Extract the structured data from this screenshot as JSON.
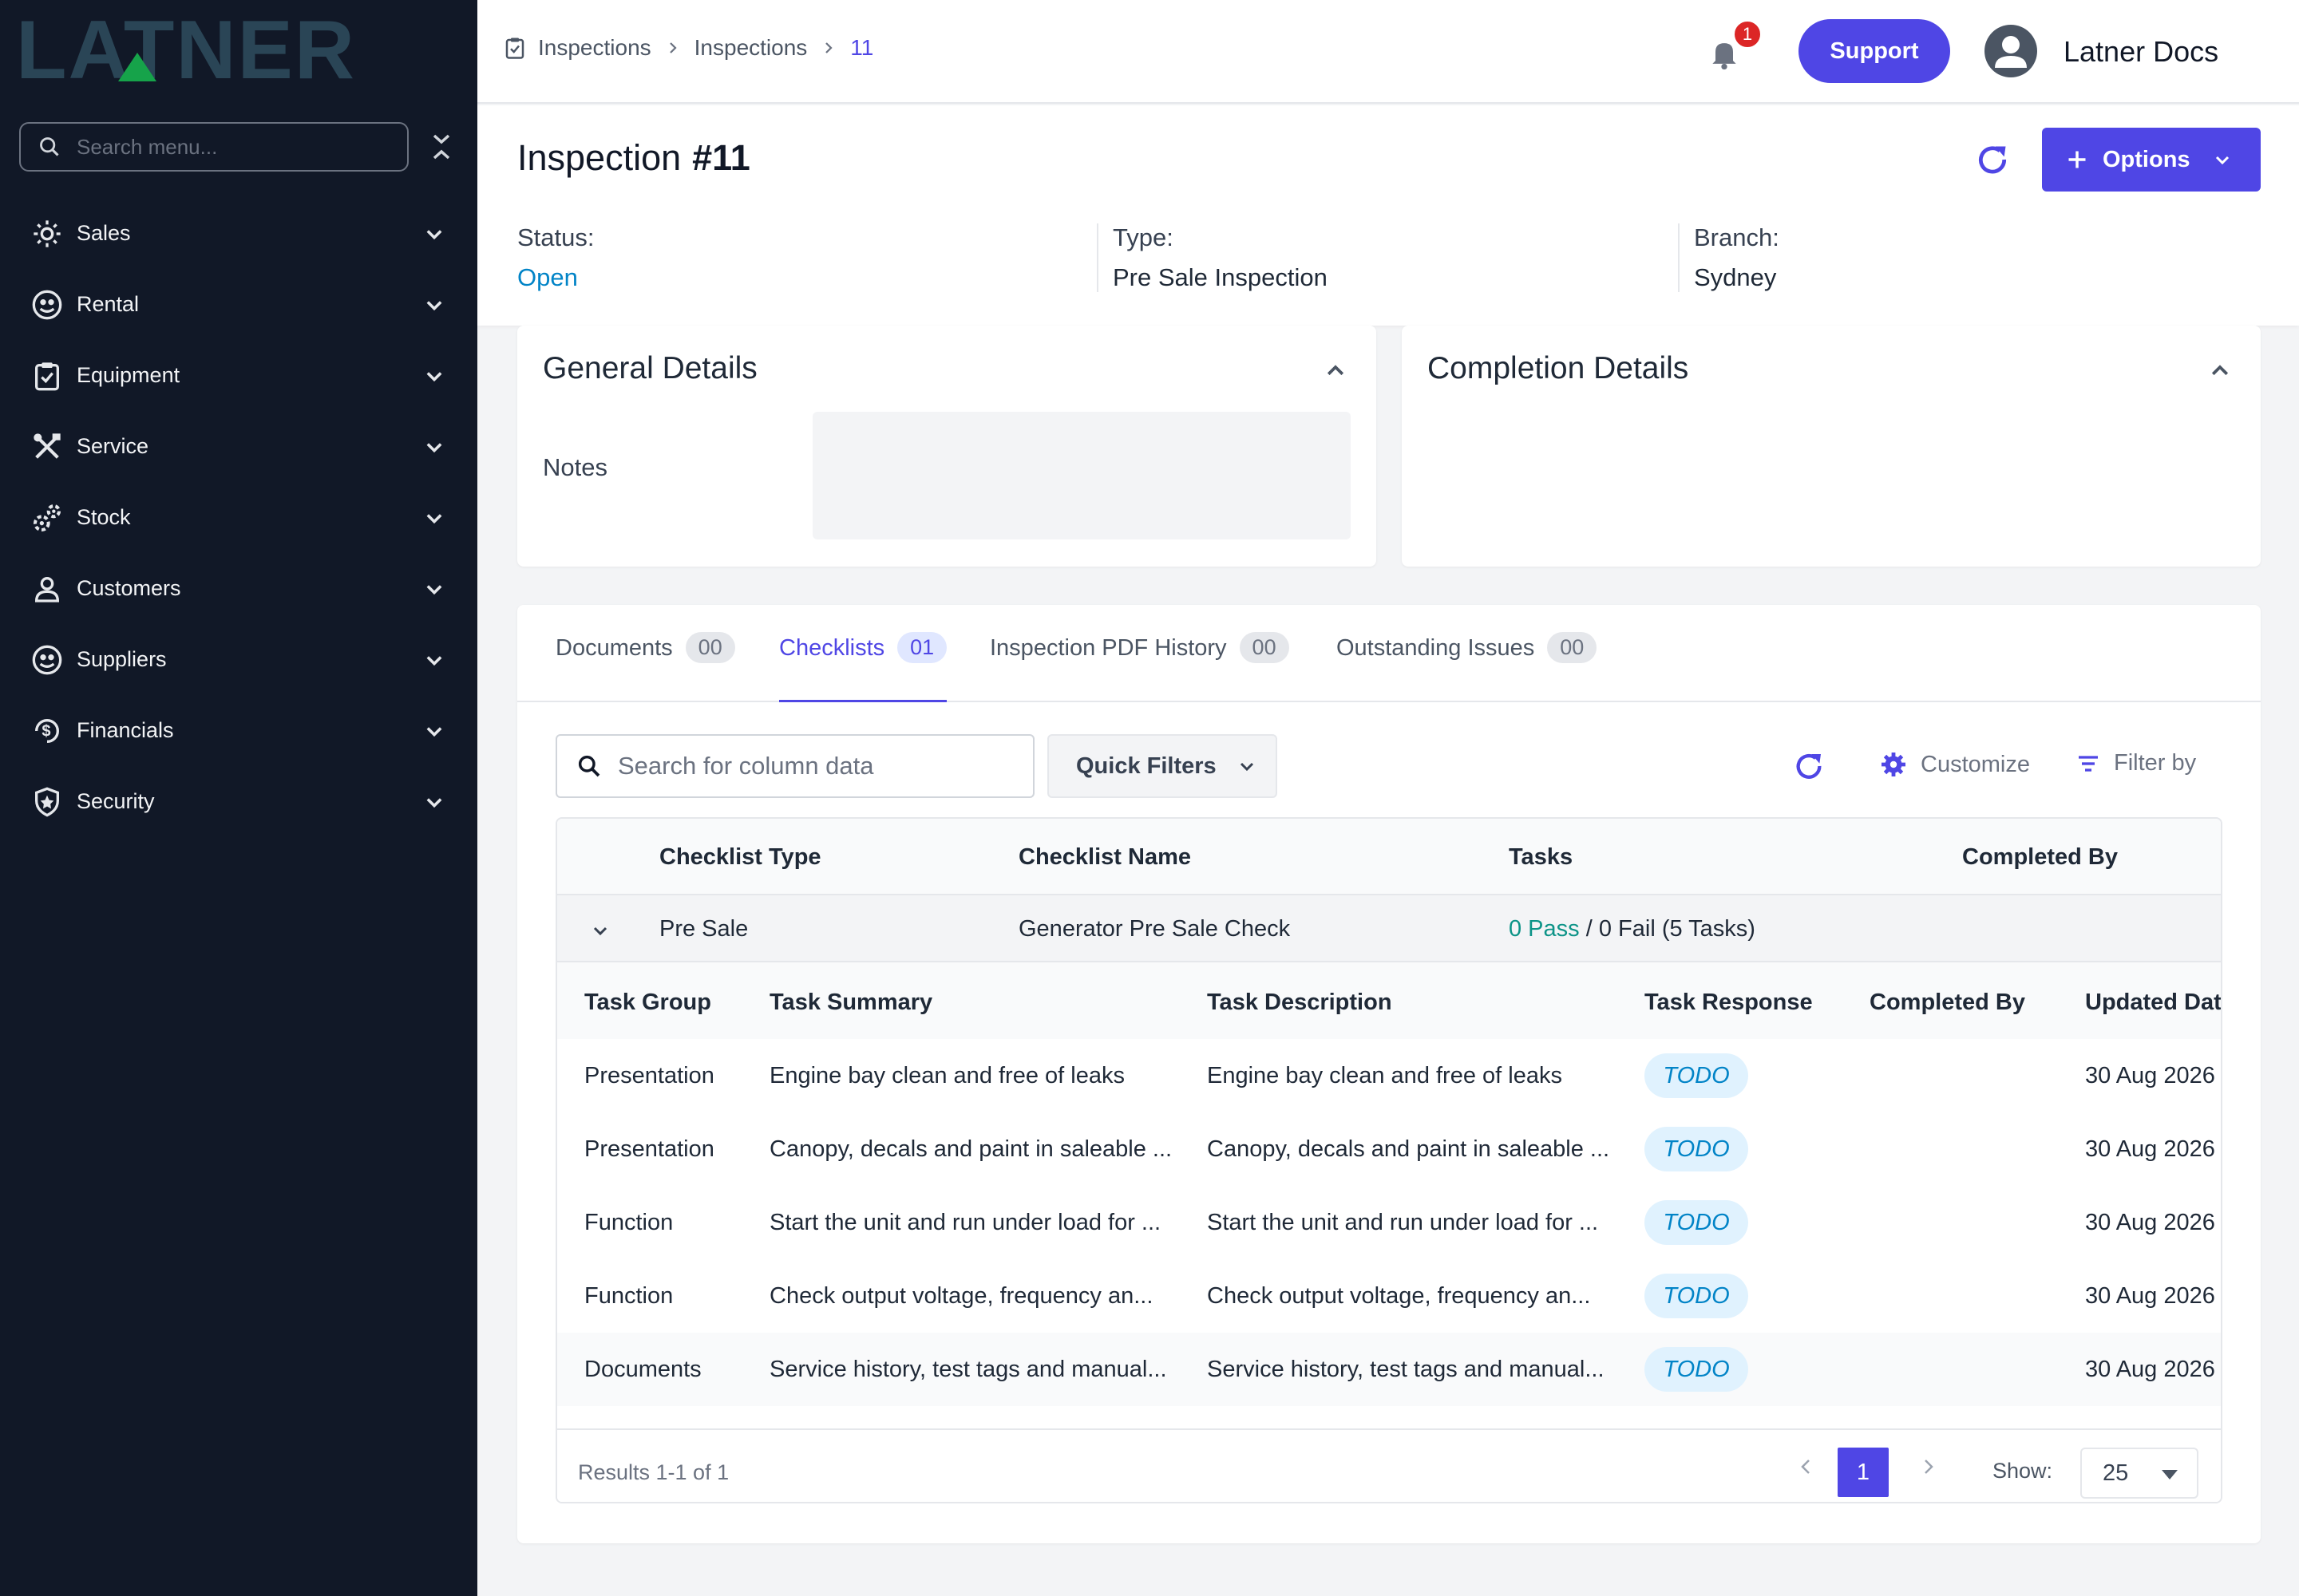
{
  "sidebar": {
    "brand": "LATNER",
    "search_placeholder": "Search menu...",
    "items": [
      {
        "label": "Sales",
        "icon": "sales-icon"
      },
      {
        "label": "Rental",
        "icon": "rental-icon"
      },
      {
        "label": "Equipment",
        "icon": "clipboard-icon"
      },
      {
        "label": "Service",
        "icon": "tools-icon"
      },
      {
        "label": "Stock",
        "icon": "gears-icon"
      },
      {
        "label": "Customers",
        "icon": "user-icon"
      },
      {
        "label": "Suppliers",
        "icon": "supplier-icon"
      },
      {
        "label": "Financials",
        "icon": "dollar-icon"
      },
      {
        "label": "Security",
        "icon": "shield-icon"
      }
    ]
  },
  "topbar": {
    "breadcrumb": [
      "Inspections",
      "Inspections",
      "11"
    ],
    "notification_count": "1",
    "support_label": "Support",
    "user_name": "Latner Docs"
  },
  "header": {
    "title": "Inspection",
    "number": "#11",
    "options_label": "Options",
    "status_label": "Status:",
    "status_value": "Open",
    "type_label": "Type:",
    "type_value": "Pre Sale Inspection",
    "branch_label": "Branch:",
    "branch_value": "Sydney"
  },
  "general": {
    "title": "General Details",
    "notes_label": "Notes"
  },
  "completion": {
    "title": "Completion Details"
  },
  "tabs": [
    {
      "label": "Documents",
      "count": "00"
    },
    {
      "label": "Checklists",
      "count": "01"
    },
    {
      "label": "Inspection PDF History",
      "count": "00"
    },
    {
      "label": "Outstanding Issues",
      "count": "00"
    }
  ],
  "toolbar": {
    "search_placeholder": "Search for column data",
    "quick_filters": "Quick Filters",
    "customize": "Customize",
    "filter_by": "Filter by"
  },
  "table": {
    "headers": [
      "Checklist Type",
      "Checklist Name",
      "Tasks",
      "Completed By"
    ],
    "row": {
      "type": "Pre Sale",
      "name": "Generator Pre Sale Check",
      "tasks_pass": "0 Pass",
      "tasks_rest": " / 0 Fail (5 Tasks)"
    },
    "sub_headers": [
      "Task Group",
      "Task Summary",
      "Task Description",
      "Task Response",
      "Completed By",
      "Updated Dat"
    ],
    "sub_rows": [
      {
        "group": "Presentation",
        "summary": "Engine bay clean and free of leaks",
        "description": "Engine bay clean and free of leaks",
        "response": "TODO",
        "completed_by": "",
        "updated": "30 Aug 2026"
      },
      {
        "group": "Presentation",
        "summary": "Canopy, decals and paint in saleable ...",
        "description": "Canopy, decals and paint in saleable ...",
        "response": "TODO",
        "completed_by": "",
        "updated": "30 Aug 2026"
      },
      {
        "group": "Function",
        "summary": "Start the unit and run under load for ...",
        "description": "Start the unit and run under load for ...",
        "response": "TODO",
        "completed_by": "",
        "updated": "30 Aug 2026"
      },
      {
        "group": "Function",
        "summary": "Check output voltage, frequency an...",
        "description": "Check output voltage, frequency an...",
        "response": "TODO",
        "completed_by": "",
        "updated": "30 Aug 2026"
      },
      {
        "group": "Documents",
        "summary": "Service history, test tags and manual...",
        "description": "Service history, test tags and manual...",
        "response": "TODO",
        "completed_by": "",
        "updated": "30 Aug 2026"
      }
    ],
    "results": "Results 1-1 of 1",
    "page": "1",
    "show_label": "Show:",
    "page_size": "25"
  },
  "colors": {
    "accent": "#4f46e5",
    "sidebar_bg": "#111827",
    "status_open": "#0284c7",
    "pass": "#0d9488",
    "badge": "#dc2626"
  }
}
